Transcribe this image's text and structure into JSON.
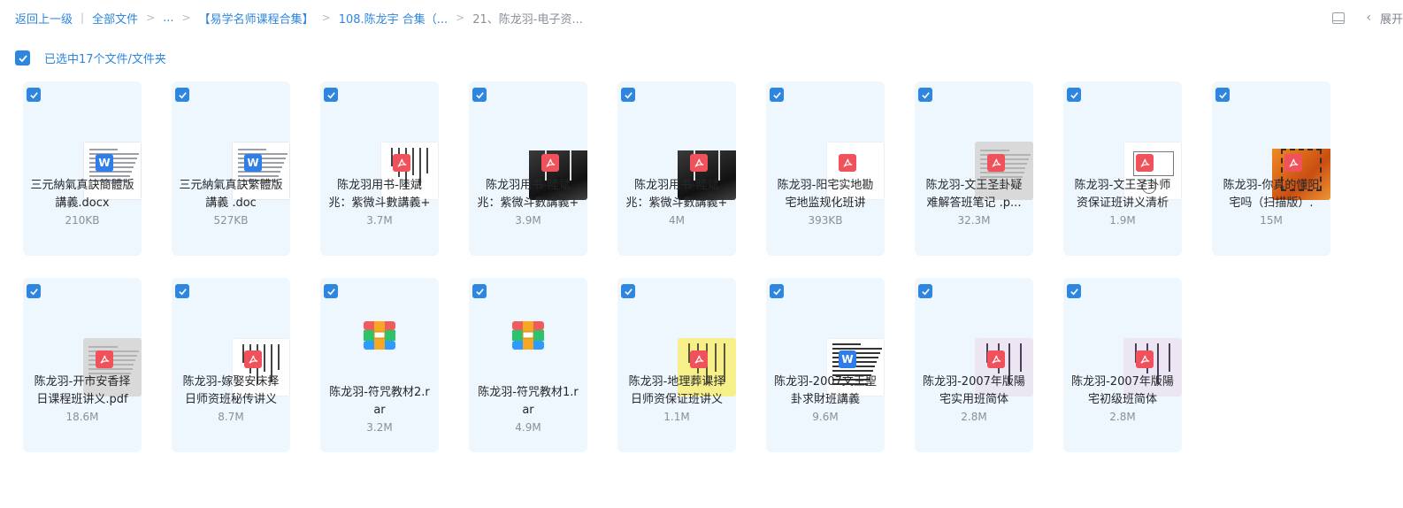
{
  "breadcrumb": {
    "back": "返回上一级",
    "all_files": "全部文件",
    "ellipsis": "...",
    "folder1": "【易学名师课程合集】",
    "folder2": "108.陈龙宇 合集（...",
    "current": "21、陈龙羽-电子资..."
  },
  "toolbar": {
    "expand_label": "展开",
    "chevron": "‹"
  },
  "selection": {
    "label": "已选中17个文件/文件夹"
  },
  "colors": {
    "accent": "#2e86de",
    "card_bg": "#eef7fd",
    "pdf": "#f0515b",
    "word": "#2f7de8"
  },
  "files": [
    {
      "name": "三元納氣真訣簡體版講義.docx",
      "size": "210KB",
      "type": "word",
      "thumb": "doc-white"
    },
    {
      "name": "三元納氣真訣繁體版講義 .doc",
      "size": "527KB",
      "type": "word",
      "thumb": "doc-white"
    },
    {
      "name": "陈龙羽用书-陸斌兆：紫微斗數講義+",
      "size": "3.7M",
      "type": "pdf",
      "thumb": "vertical-text"
    },
    {
      "name": "陈龙羽用书-陸斌兆：紫微斗數講義+",
      "size": "3.9M",
      "type": "pdf",
      "thumb": "dark-cover"
    },
    {
      "name": "陈龙羽用书-陸斌兆：紫微斗數講義+",
      "size": "4M",
      "type": "pdf",
      "thumb": "dark-cover"
    },
    {
      "name": "陈龙羽-阳宅实地勘宅地监规化班讲",
      "size": "393KB",
      "type": "pdf",
      "thumb": "blank"
    },
    {
      "name": "陈龙羽-文王圣卦疑难解答班笔记 .p...",
      "size": "32.3M",
      "type": "pdf",
      "thumb": "gray-scan"
    },
    {
      "name": "陈龙羽-文王圣卦师资保证班讲义清析",
      "size": "1.9M",
      "type": "pdf",
      "thumb": "diagram"
    },
    {
      "name": "陈龙羽-你真的懂阳宅吗（扫描版）.",
      "size": "15M",
      "type": "pdf",
      "thumb": "orange-cover"
    },
    {
      "name": "陈龙羽-开市安香择日课程班讲义.pdf",
      "size": "18.6M",
      "type": "pdf",
      "thumb": "gray-scan"
    },
    {
      "name": "陈龙羽-嫁娶安床择日师资班秘传讲义",
      "size": "8.7M",
      "type": "pdf",
      "thumb": "vertical-text"
    },
    {
      "name": "陈龙羽-符咒教材2.rar",
      "size": "3.2M",
      "type": "rar",
      "thumb": "rar"
    },
    {
      "name": "陈龙羽-符咒教材1.rar",
      "size": "4.9M",
      "type": "rar",
      "thumb": "rar"
    },
    {
      "name": "陈龙羽-地理葬课择日师资保证班讲义",
      "size": "1.1M",
      "type": "pdf",
      "thumb": "yellow-cover"
    },
    {
      "name": "陈龙羽-2007文王聖卦求財班講義",
      "size": "9.6M",
      "type": "word",
      "thumb": "dense-text"
    },
    {
      "name": "陈龙羽-2007年版陽宅实用班简体",
      "size": "2.8M",
      "type": "pdf",
      "thumb": "purple-cover"
    },
    {
      "name": "陈龙羽-2007年版陽宅初级班简体",
      "size": "2.8M",
      "type": "pdf",
      "thumb": "purple-cover"
    }
  ]
}
